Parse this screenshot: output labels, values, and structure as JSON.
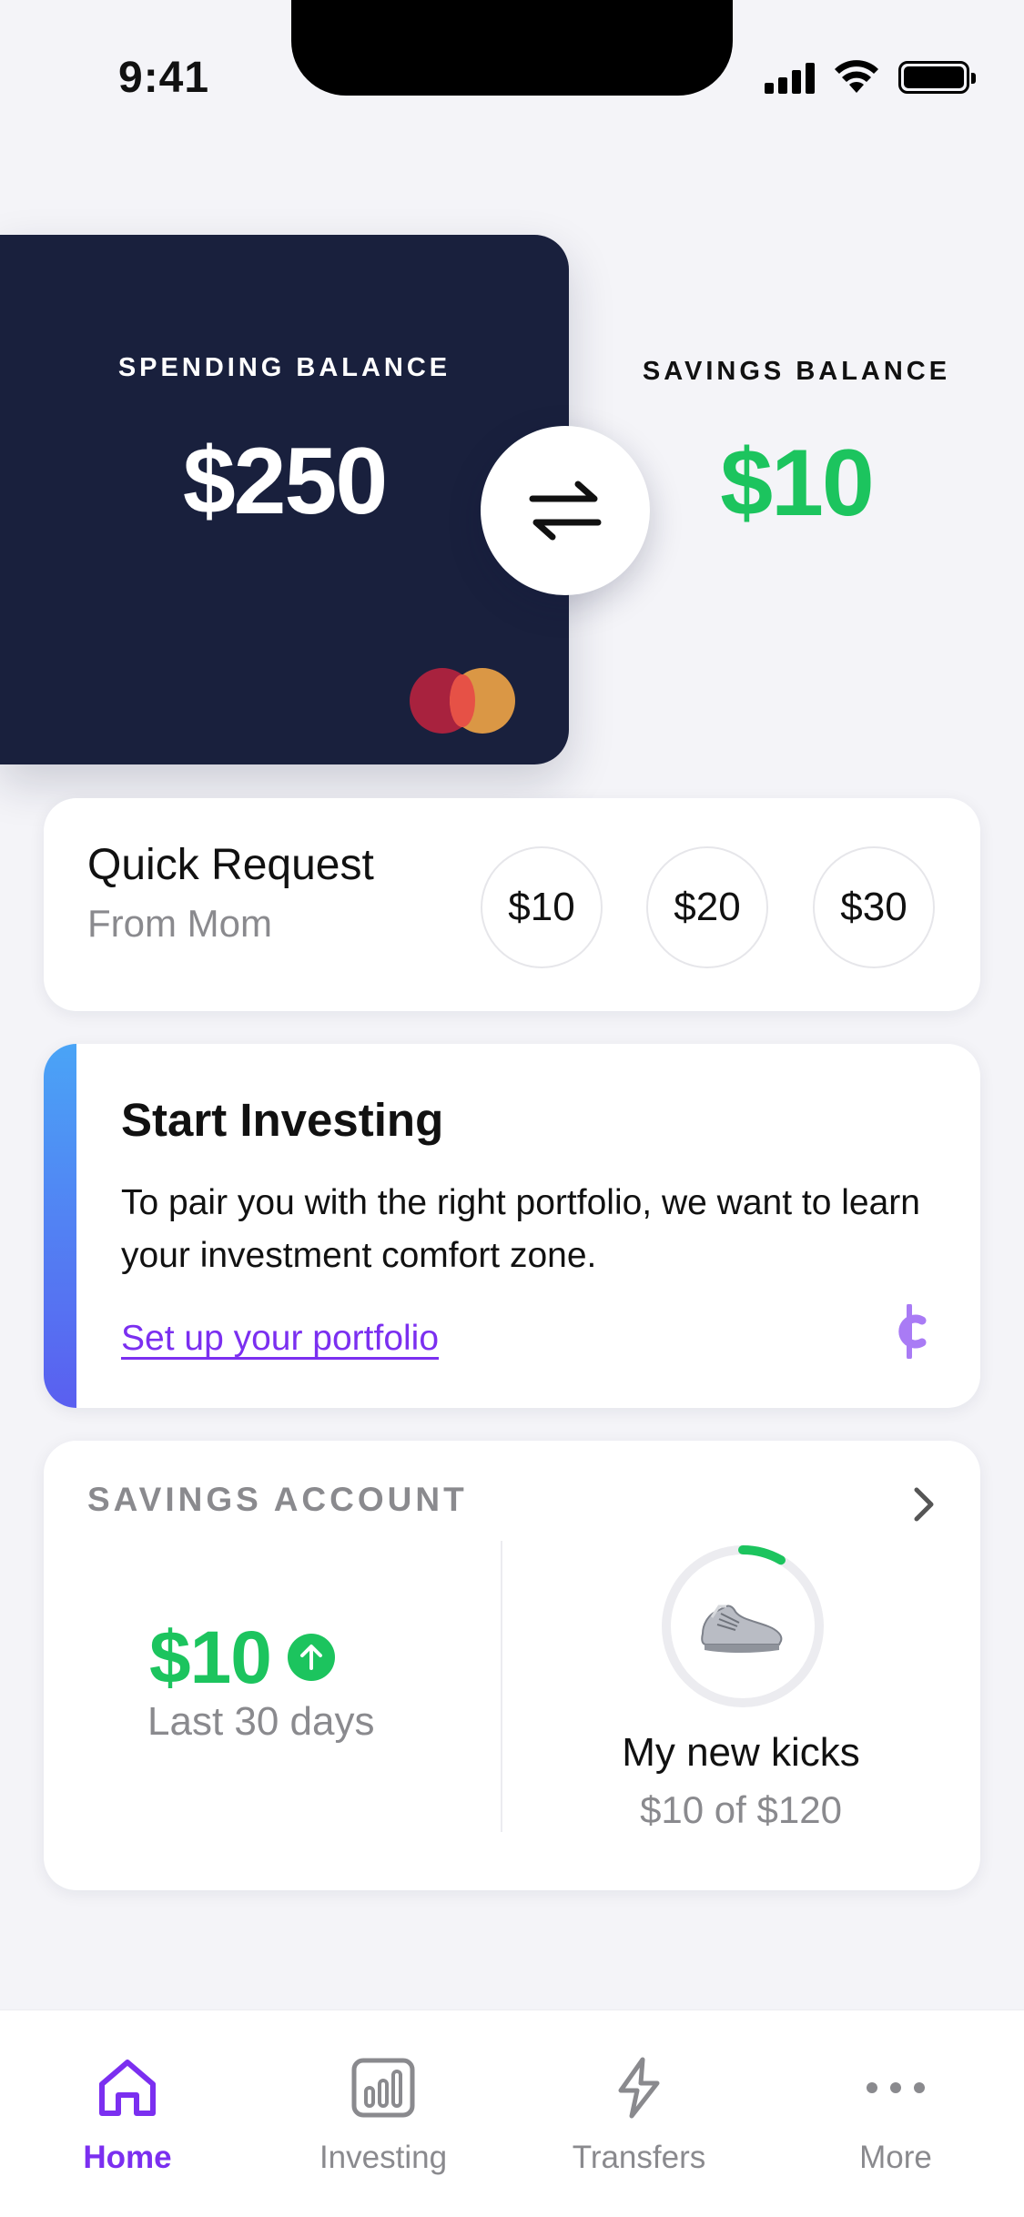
{
  "status_bar": {
    "time": "9:41"
  },
  "balances": {
    "spending_label": "SPENDING BALANCE",
    "spending_amount": "$250",
    "savings_label": "SAVINGS BALANCE",
    "savings_amount": "$10"
  },
  "quick_request": {
    "title": "Quick Request",
    "subtitle": "From Mom",
    "amounts": [
      "$10",
      "$20",
      "$30"
    ]
  },
  "investing": {
    "title": "Start Investing",
    "body": "To pair you with the right portfolio, we want to learn your investment comfort zone.",
    "link": "Set up your portfolio"
  },
  "savings_account": {
    "title": "SAVINGS ACCOUNT",
    "change_amount": "$10",
    "period": "Last 30 days",
    "goal_name": "My new kicks",
    "goal_progress_text": "$10 of $120",
    "goal_current": 10,
    "goal_target": 120
  },
  "tabs": [
    {
      "label": "Home",
      "icon": "home-icon",
      "active": true
    },
    {
      "label": "Investing",
      "icon": "investing-icon",
      "active": false
    },
    {
      "label": "Transfers",
      "icon": "transfers-icon",
      "active": false
    },
    {
      "label": "More",
      "icon": "more-icon",
      "active": false
    }
  ],
  "colors": {
    "accent": "#7b2ff0",
    "card_navy": "#19203d",
    "positive_green": "#1cc45e",
    "muted_text": "#8a8a8e",
    "background": "#f4f4f8"
  }
}
